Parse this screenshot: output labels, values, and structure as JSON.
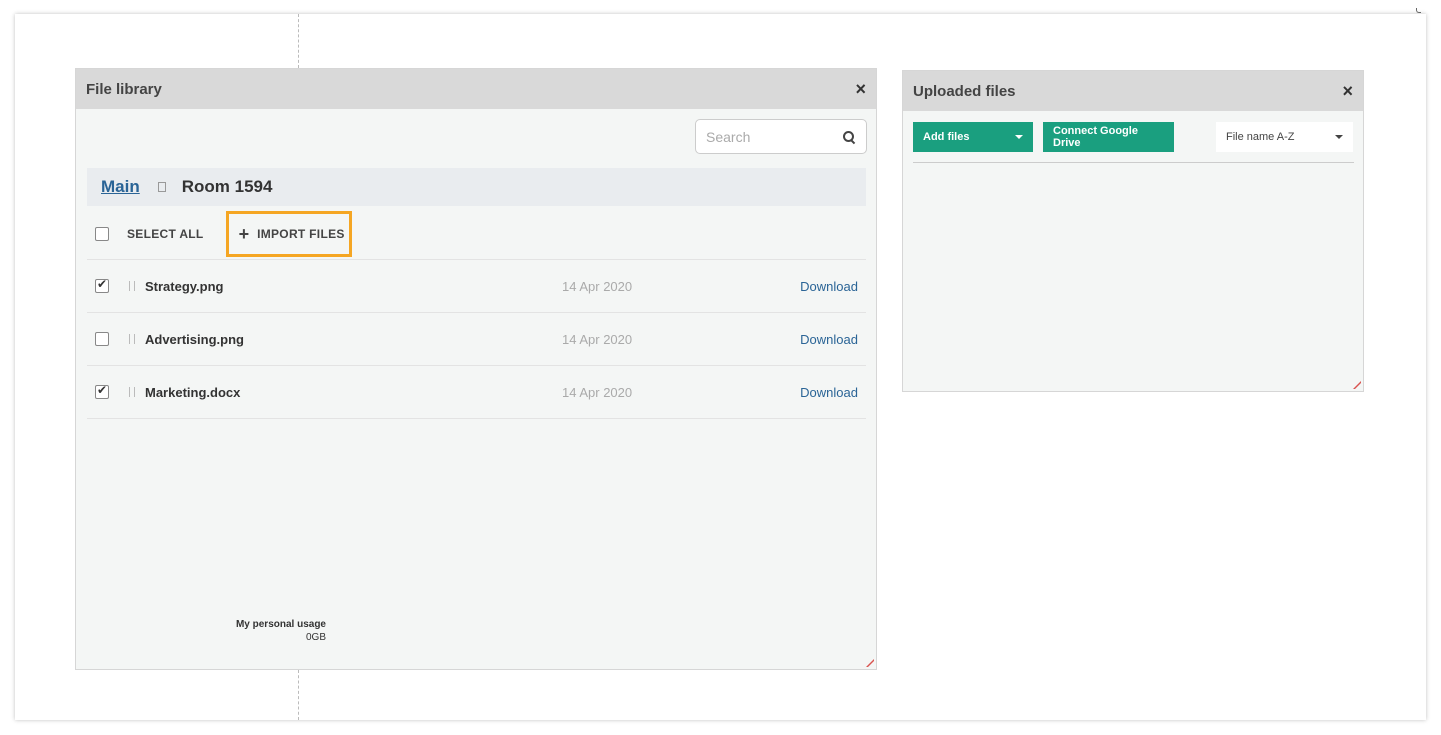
{
  "library": {
    "title": "File library",
    "close": "×",
    "search_placeholder": "Search",
    "breadcrumb": {
      "root": "Main",
      "current": "Room 1594"
    },
    "select_all": "SELECT ALL",
    "import_plus": "+",
    "import_label": "IMPORT FILES",
    "files": [
      {
        "name": "Strategy.png",
        "date": "14 Apr 2020",
        "action": "Download",
        "checked": true
      },
      {
        "name": "Advertising.png",
        "date": "14 Apr 2020",
        "action": "Download",
        "checked": false
      },
      {
        "name": "Marketing.docx",
        "date": "14 Apr 2020",
        "action": "Download",
        "checked": true
      }
    ],
    "usage_label": "My personal usage",
    "usage_value": "0GB"
  },
  "uploaded": {
    "title": "Uploaded files",
    "close": "×",
    "add_files": "Add files",
    "connect_drive": "Connect Google Drive",
    "sort_value": "File name A-Z"
  },
  "colors": {
    "accent_green": "#1a9f7f",
    "highlight_orange": "#f5a623",
    "link_blue": "#2a6496"
  }
}
